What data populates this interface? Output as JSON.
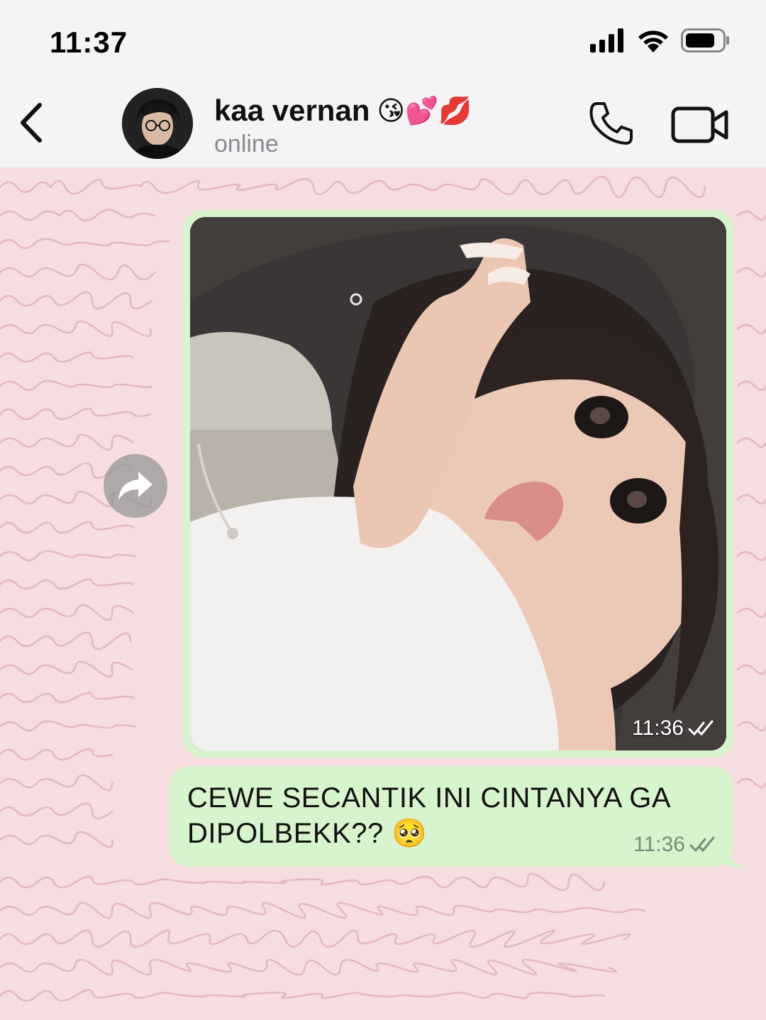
{
  "status_bar": {
    "time": "11:37",
    "icons": [
      "cellular-signal-icon",
      "wifi-icon",
      "battery-icon"
    ]
  },
  "header": {
    "contact_name": "kaa vernan",
    "contact_emoji": "😘💕💋",
    "contact_status": "online",
    "icons": [
      "back-chevron-icon",
      "phone-icon",
      "video-camera-icon"
    ]
  },
  "messages": [
    {
      "type": "image",
      "direction": "outgoing",
      "time": "11:36",
      "read_status": "double-check-icon"
    },
    {
      "type": "text",
      "direction": "outgoing",
      "text": "CEWE SECANTIK INI CINTANYA GA DIPOLBEKK?? 🥺",
      "time": "11:36",
      "read_status": "double-check-icon"
    }
  ],
  "colors": {
    "header_bg": "#f4f4f6",
    "chat_bg": "#f6dde0",
    "outgoing_bubble": "#d7f4cf",
    "status_gray": "#8a8a8e"
  }
}
